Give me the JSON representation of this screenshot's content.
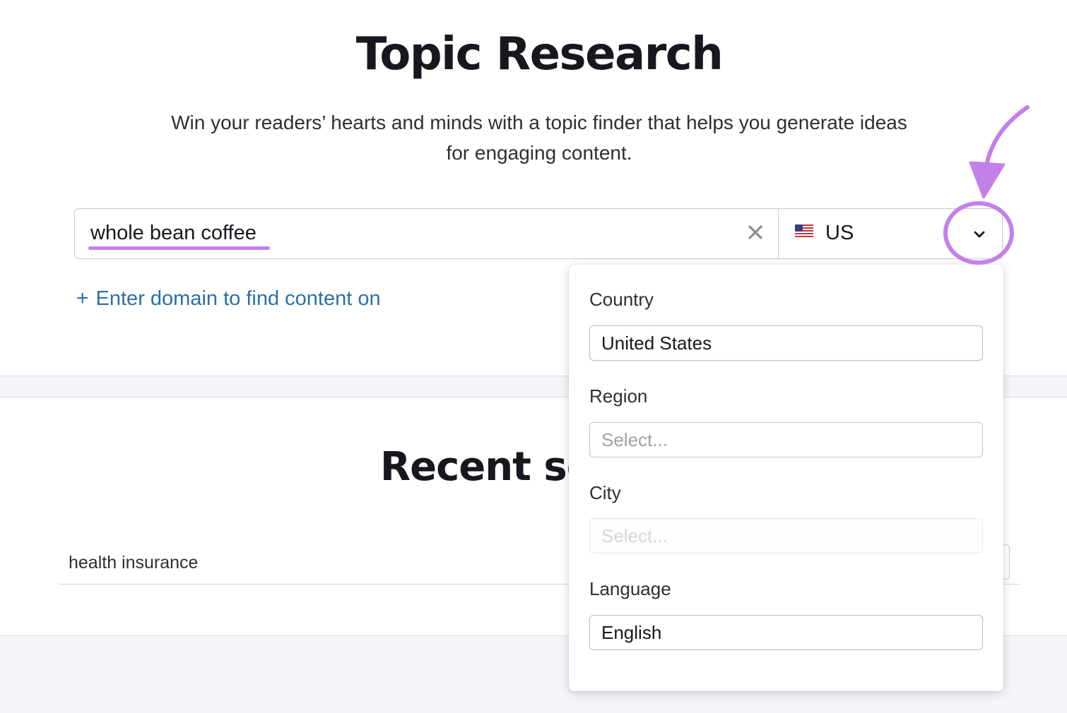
{
  "header": {
    "title": "Topic Research",
    "subtitle_line1": "Win your readers’ hearts and minds with a topic finder that helps you generate ideas",
    "subtitle_line2": "for engaging content."
  },
  "search": {
    "value": "whole bean coffee",
    "clear_icon": "close-icon",
    "country_code": "US",
    "flag_icon": "us-flag-icon",
    "chevron_icon": "chevron-down-icon",
    "add_domain_label": "Enter domain to find content on"
  },
  "recent": {
    "title": "Recent se",
    "items": [
      "health insurance"
    ]
  },
  "location_dropdown": {
    "country_label": "Country",
    "country_value": "United States",
    "region_label": "Region",
    "region_placeholder": "Select...",
    "city_label": "City",
    "city_placeholder": "Select...",
    "language_label": "Language",
    "language_value": "English"
  },
  "colors": {
    "accent_annotation": "#c480ea",
    "link": "#2f6fa5",
    "title_text": "#17181f"
  }
}
